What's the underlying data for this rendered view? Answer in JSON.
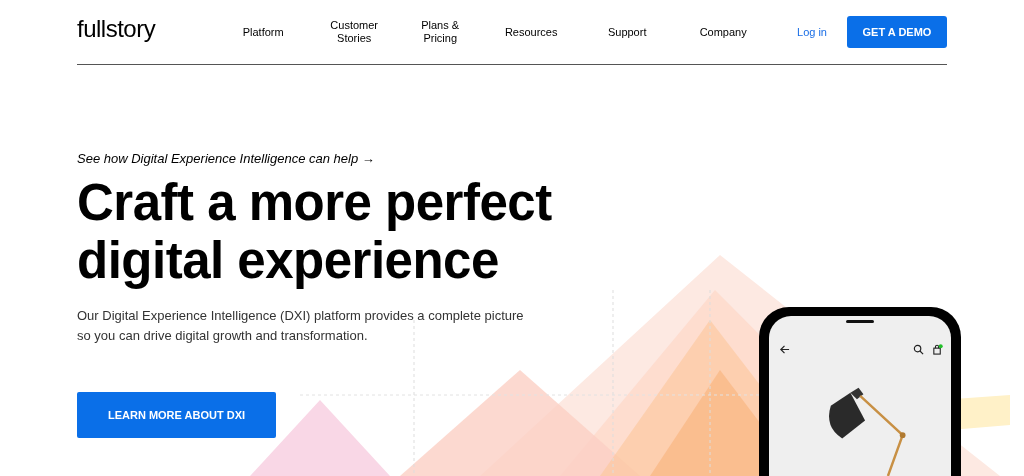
{
  "header": {
    "logo": "fullstory",
    "nav": [
      {
        "label": "Platform"
      },
      {
        "label": "Customer Stories"
      },
      {
        "label": "Plans & Pricing"
      },
      {
        "label": "Resources"
      },
      {
        "label": "Support"
      },
      {
        "label": "Company"
      }
    ],
    "login": "Log in",
    "cta": "GET A DEMO"
  },
  "hero": {
    "tagline": "See how Digital Experience Intelligence can help →",
    "title": "Craft a more perfect digital experience",
    "description": "Our Digital Experience Intelligence (DXI) platform provides a complete picture so you can drive digital growth and transformation.",
    "button": "LEARN MORE ABOUT DXI"
  }
}
